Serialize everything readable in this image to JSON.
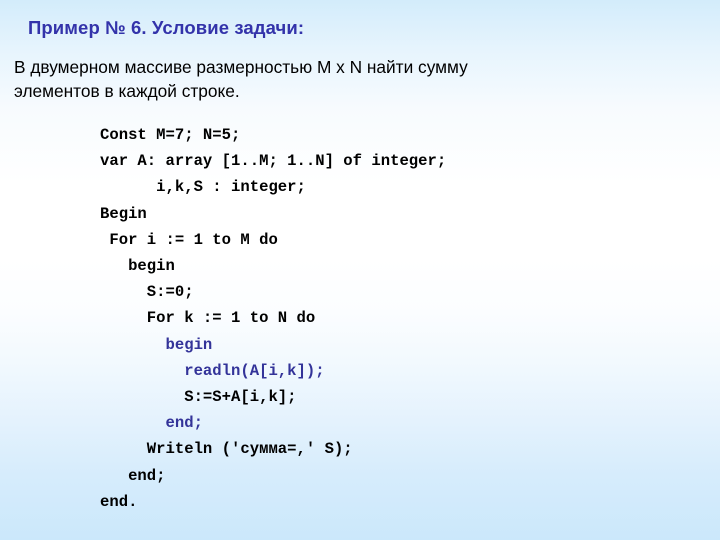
{
  "slide": {
    "title": "Пример № 6. Условие задачи:",
    "title_color": "#3333aa",
    "background_top_color": "#d3ecfb",
    "background_mid_color": "#ffffff",
    "background_bottom_color": "#cbe8fb"
  },
  "problem_statement": {
    "lines": [
      "В двумерном массиве размерностью M x N найти сумму",
      "элементов в каждой строке."
    ]
  },
  "code": {
    "language": "Pascal",
    "default_color": "#000000",
    "highlight_color": "#333399",
    "lines": [
      {
        "text": "Const M=7; N=5;",
        "color": "default"
      },
      {
        "text": "var A: array [1..M; 1..N] of integer;",
        "color": "default"
      },
      {
        "text": "      i,k,S : integer;",
        "color": "default"
      },
      {
        "text": "Begin",
        "color": "default"
      },
      {
        "text": " For i := 1 to M do",
        "color": "default"
      },
      {
        "text": "   begin",
        "color": "default"
      },
      {
        "text": "     S:=0;",
        "color": "default"
      },
      {
        "text": "     For k := 1 to N do",
        "color": "default"
      },
      {
        "text": "       begin",
        "color": "highlight"
      },
      {
        "text": "         readln(A[i,k]);",
        "color": "highlight"
      },
      {
        "text": "         S:=S+A[i,k];",
        "color": "default"
      },
      {
        "text": "       end;",
        "color": "highlight"
      },
      {
        "text": "     Writeln ('сумма=,' S);",
        "color": "default"
      },
      {
        "text": "   end;",
        "color": "default"
      },
      {
        "text": "end.",
        "color": "default"
      }
    ]
  }
}
